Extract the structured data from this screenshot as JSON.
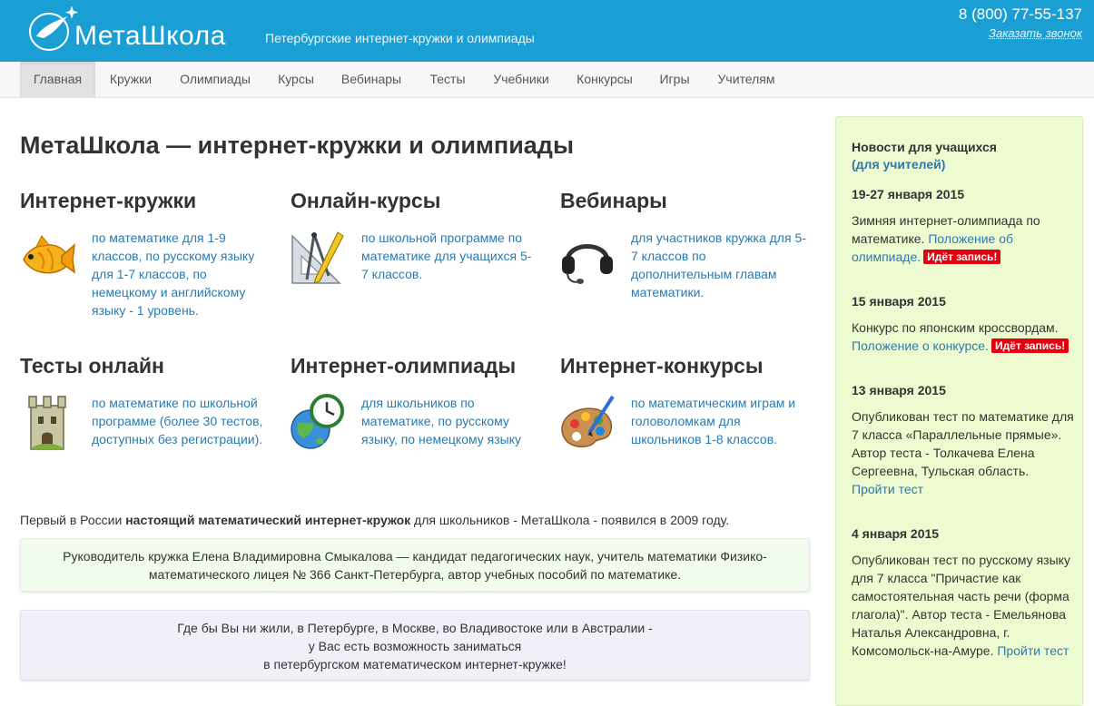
{
  "header": {
    "logo_text": "МетаШкола",
    "tagline": "Петербургские интернет-кружки и олимпиады",
    "phone": "8 (800) 77-55-137",
    "callback": "Заказать звонок"
  },
  "nav": {
    "items": [
      "Главная",
      "Кружки",
      "Олимпиады",
      "Курсы",
      "Вебинары",
      "Тесты",
      "Учебники",
      "Конкурсы",
      "Игры",
      "Учителям"
    ],
    "active": "Главная"
  },
  "main": {
    "title": "МетаШкола — интернет-кружки и олимпиады",
    "sections": [
      {
        "title": "Интернет-кружки",
        "icon": "fish-icon",
        "desc": "по математике для 1-9 классов, по русскому языку для 1-7 классов, по немецкому и английскому языку - 1 уровень."
      },
      {
        "title": "Онлайн-курсы",
        "icon": "drafting-tools-icon",
        "desc": "по школьной программе по математике для учащихся 5-7 классов."
      },
      {
        "title": "Вебинары",
        "icon": "headset-icon",
        "desc": "для участников кружка для 5-7 классов по дополнительным главам математики."
      },
      {
        "title": "Тесты онлайн",
        "icon": "castle-tower-icon",
        "desc": "по математике по школьной программе (более 30 тестов, доступных без регистрации)."
      },
      {
        "title": "Интернет-олимпиады",
        "icon": "globe-clock-icon",
        "desc": "для школьников по математике, по русскому языку, по немецкому языку"
      },
      {
        "title": "Интернет-конкурсы",
        "icon": "palette-icon",
        "desc": "по математическим играм и головоломкам для школьников 1-8 классов."
      }
    ],
    "intro_pre": "Первый в России ",
    "intro_bold": "настоящий математический интернет-кружок",
    "intro_post": " для школьников - МетаШкола - появился в 2009 году.",
    "leader_line1": "Руководитель кружка Елена Владимировна Смыкалова — кандидат педагогических наук, учитель математики Физико-",
    "leader_line2": "математического лицея № 366 Санкт-Петербурга, автор учебных пособий по математике.",
    "promo_line1": "Где бы Вы ни жили, в Петербурге, в Москве, во Владивостоке или в Австралии -",
    "promo_line2": "у Вас есть возможность заниматься",
    "promo_line3": "в петербургском математическом интернет-кружке!"
  },
  "sidebar": {
    "heading": "Новости для учащихся",
    "sub_link": "(для учителей)",
    "news": [
      {
        "date": "19-27 января 2015",
        "text": "Зимняя интернет-олимпиада по математике. ",
        "link": "Положение об олимпиаде.",
        "badge": "Идёт запись!"
      },
      {
        "date": "15 января 2015",
        "text": "Конкурс по японским кроссвордам. ",
        "link": "Положение о конкурсе.",
        "badge": "Идёт запись!"
      },
      {
        "date": "13 января 2015",
        "text": "Опубликован тест по математике для 7 класса «Параллельные прямые». Автор теста - Толкачева Елена Сергеевна, Тульская область. ",
        "link": "Пройти тест",
        "badge": ""
      },
      {
        "date": "4 января 2015",
        "text": "Опубликован тест по русскому языку для 7 класса \"Причастие как самостоятельная часть речи (форма глагола)\". Автор теста - Емельянова Наталья Александровна, г. Комсомольск-на-Амуре. ",
        "link": "Пройти тест",
        "badge": ""
      }
    ]
  }
}
